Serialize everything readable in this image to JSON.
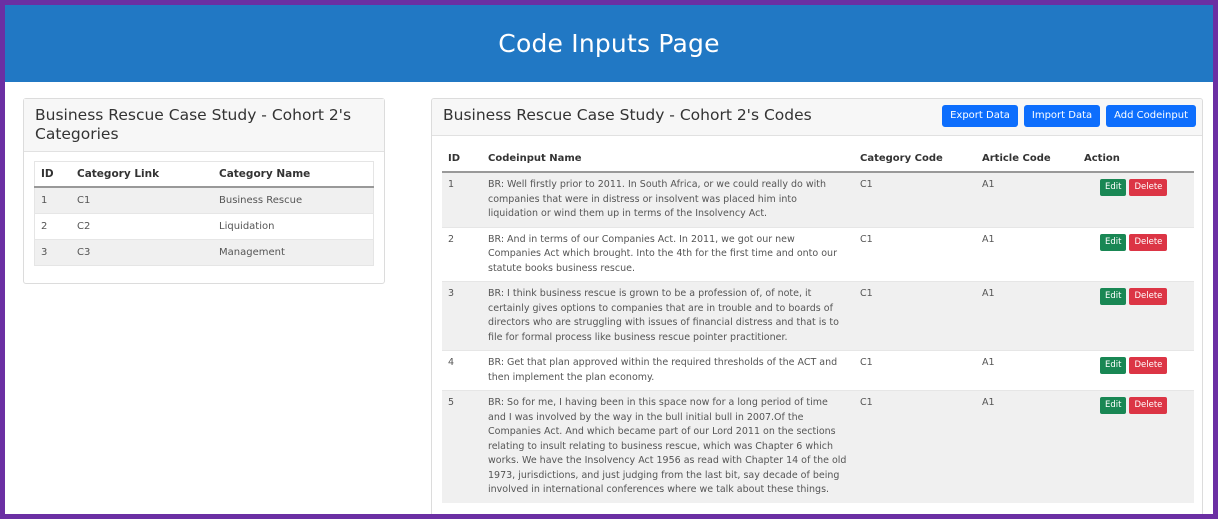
{
  "header": {
    "title": "Code Inputs Page"
  },
  "categories_panel": {
    "title": "Business Rescue Case Study - Cohort 2's Categories",
    "columns": [
      "ID",
      "Category Link",
      "Category Name"
    ],
    "rows": [
      [
        "1",
        "C1",
        "Business Rescue"
      ],
      [
        "2",
        "C2",
        "Liquidation"
      ],
      [
        "3",
        "C3",
        "Management"
      ]
    ]
  },
  "codes_panel": {
    "title": "Business Rescue Case Study - Cohort 2's Codes",
    "buttons": {
      "export": "Export Data",
      "import": "Import Data",
      "add": "Add Codeinput"
    },
    "columns": [
      "ID",
      "Codeinput Name",
      "Category Code",
      "Article Code",
      "Action"
    ],
    "action_labels": {
      "edit": "Edit",
      "delete": "Delete"
    },
    "rows": [
      [
        "1",
        "BR: Well firstly prior to 2011. In South Africa, or we could really do with companies that were in distress or insolvent was placed him into liquidation or wind them up in terms of the Insolvency Act.",
        "C1",
        "A1"
      ],
      [
        "2",
        "BR: And in terms of our Companies Act. In 2011, we got our new Companies Act which brought. Into the 4th for the first time and onto our statute books business rescue.",
        "C1",
        "A1"
      ],
      [
        "3",
        "BR: I think business rescue is grown to be a profession of, of note, it certainly gives options to companies that are in trouble and to boards of directors who are struggling with issues of financial distress and that is to file for formal process like business rescue pointer practitioner.",
        "C1",
        "A1"
      ],
      [
        "4",
        "BR: Get that plan approved within the required thresholds of the ACT and then implement the plan economy.",
        "C1",
        "A1"
      ],
      [
        "5",
        "BR: So for me, I having been in this space now for a long period of time and I was involved by the way in the bull initial bull in 2007.Of the Companies Act. And which became part of our Lord 2011 on the sections relating to insult relating to business rescue, which was Chapter 6 which works. We have the Insolvency Act 1956 as read with Chapter 14 of the old 1973, jurisdictions, and just judging from the last bit, say decade of being involved in international conferences where we talk about these things.",
        "C1",
        "A1"
      ]
    ]
  },
  "colors": {
    "header_bg": "#2178c4",
    "frame_border": "#6b2fa3",
    "primary_button": "#0d6efd",
    "edit_button": "#198754",
    "delete_button": "#dc3545"
  }
}
